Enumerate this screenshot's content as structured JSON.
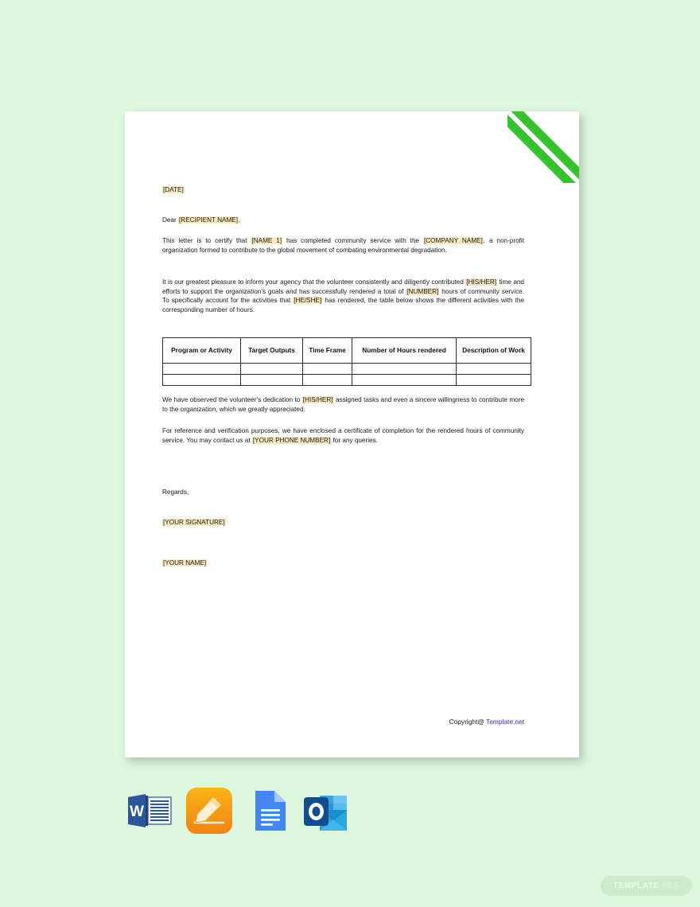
{
  "background_color": "#ddf7de",
  "document": {
    "corner_decoration": {
      "name": "green-diagonal-stripes",
      "color": "#35c22e",
      "stripe_count": 2
    },
    "date_line": "[DATE]",
    "salutation_prefix": "Dear ",
    "salutation_placeholder": "[RECIPIENT NAME]",
    "salutation_suffix": ",",
    "paragraph_1": {
      "part_1": "This letter is to certify that ",
      "ph_1": "[NAME 1]",
      "part_2": " has completed community service with the ",
      "ph_2": "[COMPANY NAME]",
      "part_3": ", a non-profit organization formed to contribute to the global movement of combating environmental degradation."
    },
    "paragraph_2": {
      "part_1": "It is our greatest pleasure to inform your agency that the volunteer consistently and diligently contributed ",
      "ph_1": "[HIS/HER]",
      "part_2": " time and efforts to support the organization’s goals and has successfully rendered a total of ",
      "ph_2": "[NUMBER]",
      "part_3": " hours of community service. To specifically account for the activities that ",
      "ph_3": "[HE/SHE]",
      "part_4": " has rendered, the table below shows the different activities with the corresponding number of hours."
    },
    "table": {
      "headers": [
        "Program or Activity",
        "Target Outputs",
        "Time Frame",
        "Number of Hours rendered",
        "Description of Work"
      ],
      "empty_row_count": 2
    },
    "paragraph_3": {
      "part_1": "We have observed the volunteer’s dedication to ",
      "ph_1": "[HIS/HER]",
      "part_2": " assigned tasks and even a sincere willingness to contribute more to the organization, which we greatly appreciated."
    },
    "paragraph_4": {
      "part_1": "For reference and verification purposes, we have enclosed a certificate of completion for the rendered hours of community service. You may contact us at ",
      "ph_1": "[YOUR PHONE NUMBER]",
      "part_2": " for any queries."
    },
    "closing": "Regards,",
    "signature_placeholder": "[YOUR SIGNATURE]",
    "name_placeholder": "[YOUR NAME]",
    "copyright_prefix": "Copyright@ ",
    "copyright_link": "Template.net",
    "copyright_link_color": "#3b30cf",
    "highlight_color": "#fbe8bf"
  },
  "app_icons": [
    {
      "name": "microsoft-word-icon",
      "label": "W"
    },
    {
      "name": "apple-pages-icon",
      "label": ""
    },
    {
      "name": "google-docs-icon",
      "label": ""
    },
    {
      "name": "microsoft-outlook-icon",
      "label": ""
    }
  ],
  "watermark": {
    "text_main": "TEMPLATE",
    "text_suffix": ".NET"
  }
}
